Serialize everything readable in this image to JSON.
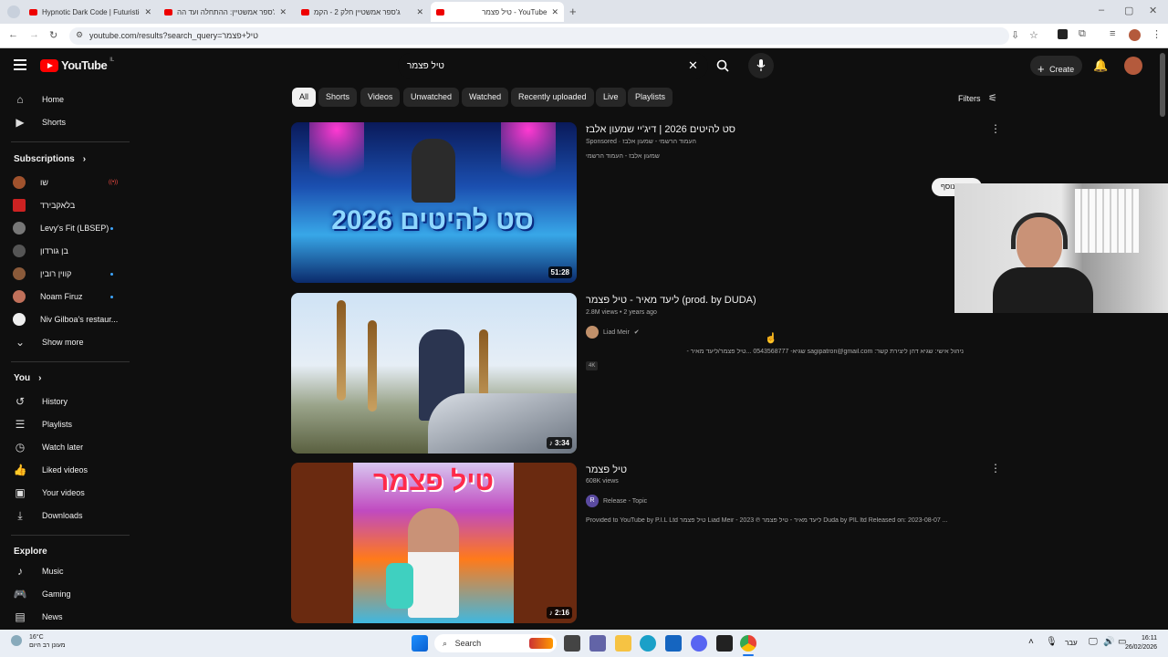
{
  "browser": {
    "tabs": [
      {
        "title": "Hypnotic Dark Code | Futuristic"
      },
      {
        "title": "ג'ספר אמשטיין: ההתחלה ועד הה"
      },
      {
        "title": "ג'ספר אמשטיין חלק 2 - הקמ"
      },
      {
        "title": "טיל פצמר - YouTube"
      }
    ],
    "url": "youtube.com/results?search_query=טיל+פצמר"
  },
  "header": {
    "logo_text": "YouTube",
    "logo_region": "IL",
    "search_value": "טיל פצמר",
    "create_label": "Create"
  },
  "sidebar": {
    "main": [
      {
        "label": "Home",
        "icon": "home-icon"
      },
      {
        "label": "Shorts",
        "icon": "shorts-icon"
      }
    ],
    "subscriptions_title": "Subscriptions",
    "subscriptions": [
      {
        "label": "שו",
        "color": "#a0522d"
      },
      {
        "label": "בלאקבירד",
        "color": "#cc2222"
      },
      {
        "label": "Levy's Fit (LBSEP)",
        "color": "#777777"
      },
      {
        "label": "בן גורדון",
        "color": "#555555"
      },
      {
        "label": "קווין רובין",
        "color": "#8a5a3a"
      },
      {
        "label": "Noam Firuz",
        "color": "#c0705a"
      },
      {
        "label": "Niv Gilboa's restaur...",
        "color": "#eeeeee"
      }
    ],
    "show_more": "Show more",
    "you_title": "You",
    "you": [
      {
        "label": "History",
        "icon": "history-icon"
      },
      {
        "label": "Playlists",
        "icon": "playlists-icon"
      },
      {
        "label": "Watch later",
        "icon": "watch-later-icon"
      },
      {
        "label": "Liked videos",
        "icon": "like-icon"
      },
      {
        "label": "Your videos",
        "icon": "your-videos-icon"
      },
      {
        "label": "Downloads",
        "icon": "download-icon"
      }
    ],
    "explore_title": "Explore",
    "explore": [
      {
        "label": "Music",
        "icon": "music-icon"
      },
      {
        "label": "Gaming",
        "icon": "gaming-icon"
      },
      {
        "label": "News",
        "icon": "news-icon"
      }
    ]
  },
  "chips": [
    "All",
    "Shorts",
    "Videos",
    "Unwatched",
    "Watched",
    "Recently uploaded",
    "Live",
    "Playlists"
  ],
  "filters_label": "Filters",
  "results": [
    {
      "title": "סט להיטים 2026 | דיג'יי שמעון אלבז",
      "meta": "Sponsored · העמוד הרשמי - שמעון אלבז",
      "channel": "שמעון אלבז - העמוד הרשמי",
      "duration": "51:28",
      "thumb_text": "סט להיטים 2026"
    },
    {
      "title": "ליעד מאיר - טיל פצמר (prod. by DUDA)",
      "meta": "2.8M views • 2 years ago",
      "channel": "Liad Meir",
      "desc": "ניהול אישי: שגיא דהן ליצירת קשר: sagipatron@gmail.com שגיא- 0543568777 ...טיל פצמר/ליעד מאיר -",
      "badge": "4K",
      "duration": "3:34"
    },
    {
      "title": "טיל פצמר",
      "meta": "608K views",
      "channel": "Release - Topic",
      "channel_initial": "R",
      "desc": "Provided to YouTube by P.I.L Ltd טיל פצמר Liad Meir - ליעד מאיר - טיל פצמר ℗ 2023 Duda by PIL ltd Released on: 2023-08-07 ...",
      "duration": "2:16",
      "thumb_text": "טיל פצמר"
    }
  ],
  "overlay_pill": "נוסף",
  "taskbar": {
    "weather_temp": "16°C",
    "weather_desc": "מעונן רב היום",
    "search_label": "Search",
    "lang": "עבר",
    "time": "16:11",
    "date": "26/02/2026"
  }
}
